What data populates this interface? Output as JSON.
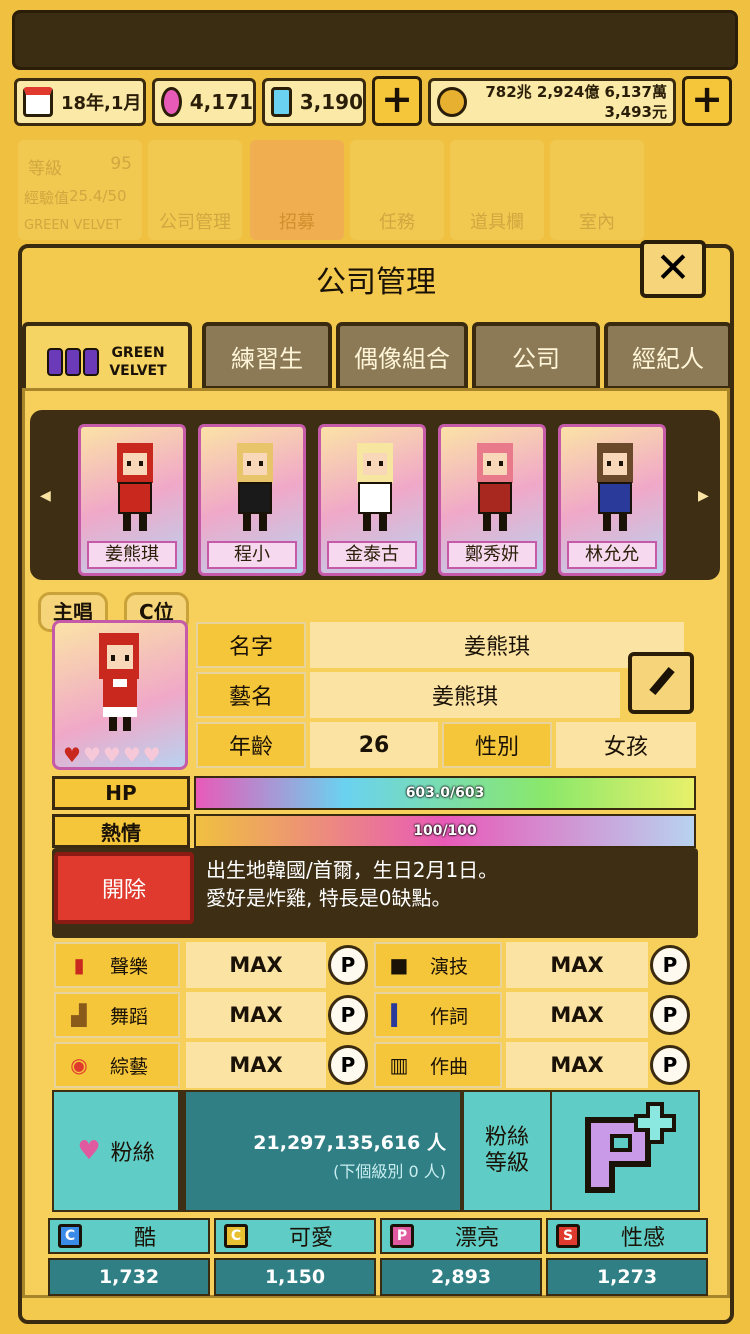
{
  "resources": {
    "date": "18年,1月",
    "pink_gem": "4,171",
    "blue_gem": "3,190",
    "money_line1": "782兆 2,924億 6,137萬",
    "money_line2": "3,493元"
  },
  "background_menu": {
    "level_label": "等級",
    "level_value": "95",
    "exp_label": "經驗值",
    "exp_value": "25.4/50",
    "group": "GREEN VELVET",
    "items": [
      "公司管理",
      "招募",
      "任務",
      "道具欄",
      "室內"
    ]
  },
  "dialog": {
    "title": "公司管理",
    "close_icon": "close-icon"
  },
  "tabs": {
    "active_line1": "GREEN",
    "active_line2": "VELVET",
    "items": [
      "練習生",
      "偶像組合",
      "公司",
      "經紀人"
    ]
  },
  "roster": [
    {
      "name": "姜熊琪",
      "hair": "#c8281e",
      "outfit": "#c8281e"
    },
    {
      "name": "程小",
      "hair": "#e8c46a",
      "outfit": "#1a1a1a"
    },
    {
      "name": "金泰古",
      "hair": "#f6e6a0",
      "outfit": "#ffffff"
    },
    {
      "name": "鄭秀妍",
      "hair": "#e87a8c",
      "outfit": "#a82820"
    },
    {
      "name": "林允允",
      "hair": "#6a4a2a",
      "outfit": "#2a3a9a"
    }
  ],
  "profile": {
    "role1": "主唱",
    "role2": "C位",
    "name_label": "名字",
    "name_value": "姜熊琪",
    "stage_label": "藝名",
    "stage_value": "姜熊琪",
    "age_label": "年齡",
    "age_value": "26",
    "gender_label": "性別",
    "gender_value": "女孩",
    "hearts_filled": 1,
    "hearts_total": 5
  },
  "stats": {
    "hp_label": "HP",
    "hp_text": "603.0/603",
    "hp_fraction": 1.0,
    "passion_label": "熱情",
    "passion_text": "100/100",
    "passion_fraction": 1.0
  },
  "fire_button": "開除",
  "description": {
    "line1": "出生地韓國/首爾，生日2月1日。",
    "line2": "愛好是炸雞, 特長是0缺點。"
  },
  "skills": [
    {
      "label": "聲樂",
      "value": "MAX",
      "icon": "mic-icon"
    },
    {
      "label": "演技",
      "value": "MAX",
      "icon": "camera-icon"
    },
    {
      "label": "舞蹈",
      "value": "MAX",
      "icon": "shoe-icon"
    },
    {
      "label": "作詞",
      "value": "MAX",
      "icon": "pen-icon"
    },
    {
      "label": "綜藝",
      "value": "MAX",
      "icon": "smile-icon"
    },
    {
      "label": "作曲",
      "value": "MAX",
      "icon": "piano-icon"
    }
  ],
  "p_label": "P",
  "fans": {
    "label": "粉絲",
    "count": "21,297,135,616 人",
    "next": "(下個級別 0 人)",
    "level_label_1": "粉絲",
    "level_label_2": "等級",
    "level_letter": "P"
  },
  "attributes": [
    {
      "letter": "C",
      "label": "酷",
      "value": "1,732",
      "color": "#3a8ae8"
    },
    {
      "letter": "C",
      "label": "可愛",
      "value": "1,150",
      "color": "#e8c030"
    },
    {
      "letter": "P",
      "label": "漂亮",
      "value": "2,893",
      "color": "#e05aa0"
    },
    {
      "letter": "S",
      "label": "性感",
      "value": "1,273",
      "color": "#e03a2e"
    }
  ]
}
